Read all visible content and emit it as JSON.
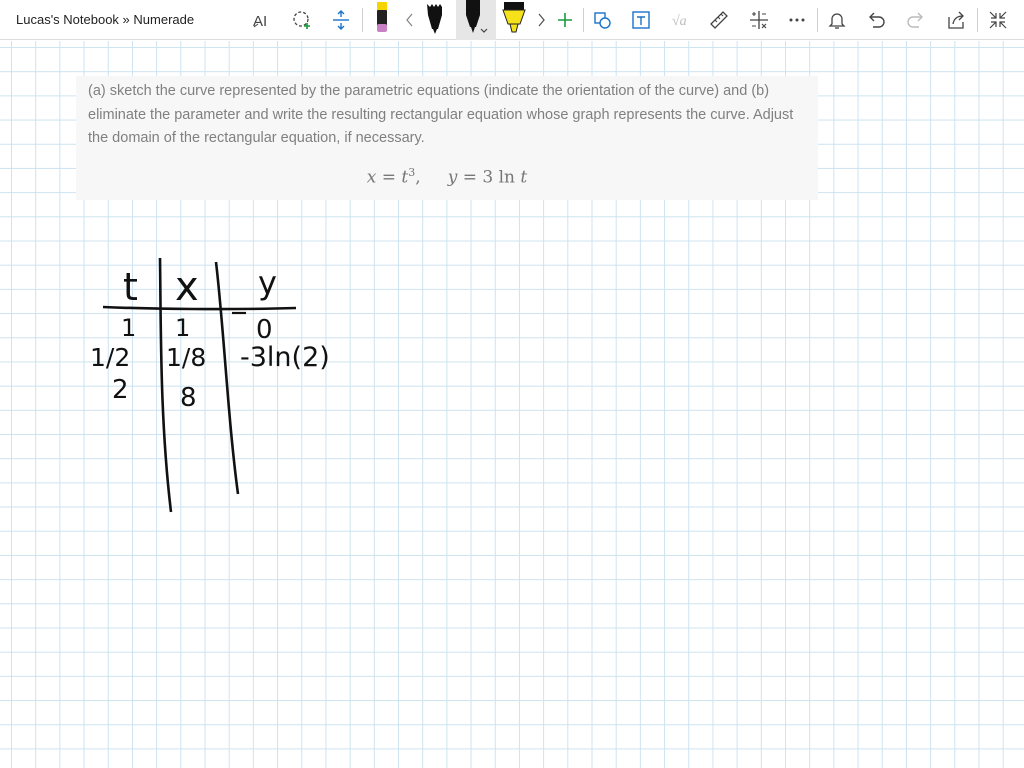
{
  "window": {
    "title": "Lucas's Notebook » Numerade"
  },
  "toolbar": {
    "icons": [
      "text-style-icon",
      "lasso-select-icon",
      "insert-space-icon",
      "pen-pink",
      "prev-arrow-icon",
      "pen-black-sketch",
      "pen-black-active",
      "highlighter-yellow",
      "next-arrow-icon",
      "add-pen-icon",
      "ink-to-shape-icon",
      "ink-to-text-icon",
      "ink-to-math-icon",
      "ruler-icon",
      "math-icon",
      "more-icon",
      "notifications-icon",
      "undo-icon",
      "redo-icon",
      "share-icon",
      "fullscreen-icon"
    ],
    "colors": {
      "pen_pink": "#c781c4",
      "pen_black": "#111111",
      "highlighter": "#f5e21a",
      "accent": "#1a73c9"
    }
  },
  "problem": {
    "text": "(a) sketch the curve represented by the parametric equations (indicate the orientation of the curve) and (b) eliminate the parameter and write the resulting rectangular equation whose graph represents the curve. Adjust the domain of the rectangular equation, if necessary.",
    "eq_x_lhs": "x",
    "eq_x_eq": " = ",
    "eq_x_var": "t",
    "eq_x_exp": "3",
    "eq_sep": ",     ",
    "eq_y_lhs": "y",
    "eq_y_eq": " = 3 ln ",
    "eq_y_var": "t"
  },
  "handwriting": {
    "headers": [
      "t",
      "x",
      "y"
    ],
    "rows": [
      [
        "1",
        "1",
        "0"
      ],
      [
        "1/2",
        "1/8",
        "-3ln(2)"
      ],
      [
        "2",
        "8",
        ""
      ]
    ]
  }
}
